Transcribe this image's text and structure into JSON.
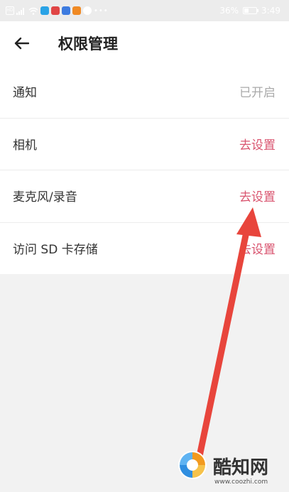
{
  "status_bar": {
    "hd_label": "HD",
    "dots": "•••",
    "battery_percent": "36%",
    "battery_level": 0.36,
    "time": "3:49"
  },
  "header": {
    "back_icon": "arrow-left-icon",
    "title": "权限管理"
  },
  "permissions": [
    {
      "label": "通知",
      "status": "已开启",
      "status_kind": "enabled"
    },
    {
      "label": "相机",
      "status": "去设置",
      "status_kind": "action"
    },
    {
      "label": "麦克风/录音",
      "status": "去设置",
      "status_kind": "action"
    },
    {
      "label": "访问 SD 卡存储",
      "status": "去设置",
      "status_kind": "action"
    }
  ],
  "colors": {
    "accent": "#d9546f",
    "status_muted": "#aaaaaa",
    "annotation_arrow": "#e8453c"
  },
  "watermark": {
    "brand": "酷知网",
    "url": "www.coozhi.com"
  }
}
